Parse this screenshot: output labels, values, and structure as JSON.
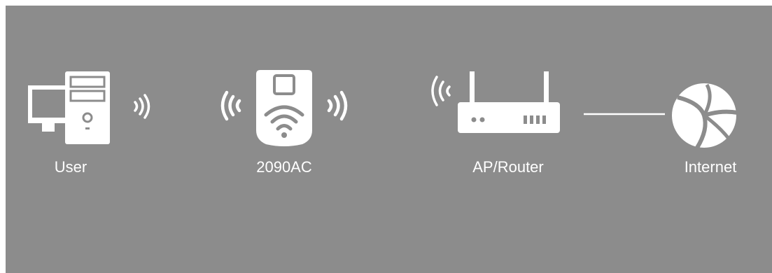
{
  "diagram": {
    "background_color": "#8c8c8c",
    "icon_color": "#ffffff",
    "nodes": [
      {
        "id": "user",
        "label": "User",
        "icon": "computer-icon"
      },
      {
        "id": "extender",
        "label": "2090AC",
        "icon": "range-extender-icon"
      },
      {
        "id": "router",
        "label": "AP/Router",
        "icon": "router-icon"
      },
      {
        "id": "internet",
        "label": "Internet",
        "icon": "globe-icon"
      }
    ],
    "connections": [
      {
        "from": "user",
        "to": "extender",
        "type": "wireless"
      },
      {
        "from": "extender",
        "to": "router",
        "type": "wireless"
      },
      {
        "from": "router",
        "to": "internet",
        "type": "wired"
      }
    ]
  }
}
